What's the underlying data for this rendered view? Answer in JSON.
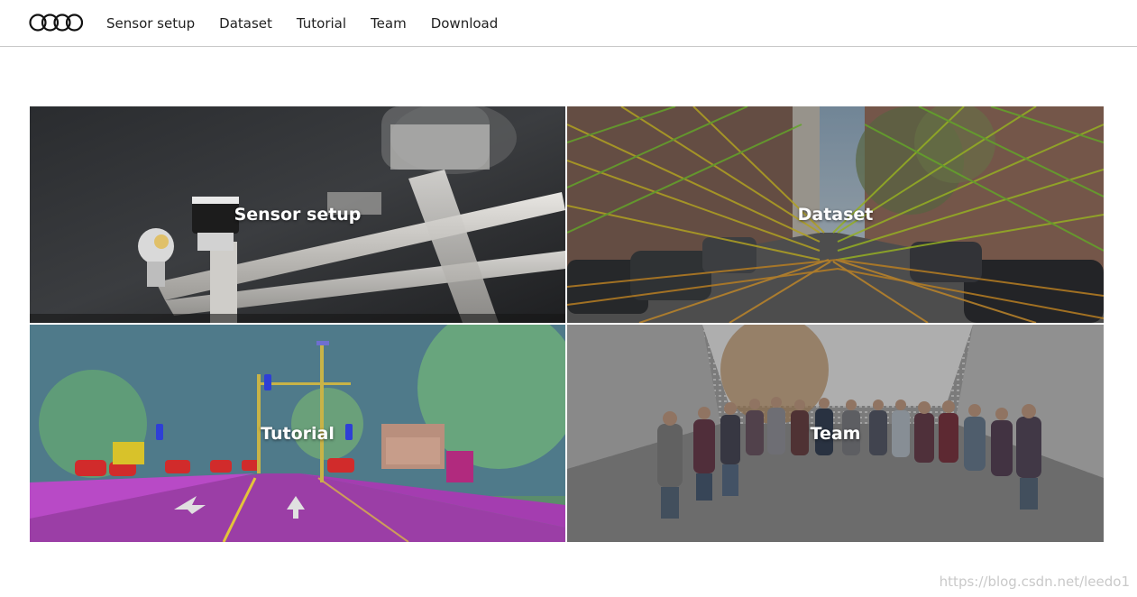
{
  "nav": {
    "logo_icon": "audi-rings-icon",
    "items": [
      {
        "label": "Sensor setup"
      },
      {
        "label": "Dataset"
      },
      {
        "label": "Tutorial"
      },
      {
        "label": "Team"
      },
      {
        "label": "Download"
      }
    ]
  },
  "tiles": [
    {
      "label": "Sensor setup",
      "image": "lidar-sensor-rig-photo"
    },
    {
      "label": "Dataset",
      "image": "street-lidar-projection-photo"
    },
    {
      "label": "Tutorial",
      "image": "semantic-segmentation-street-photo"
    },
    {
      "label": "Team",
      "image": "team-point-cloud-photo"
    }
  ],
  "watermark": "https://blog.csdn.net/leedo1"
}
